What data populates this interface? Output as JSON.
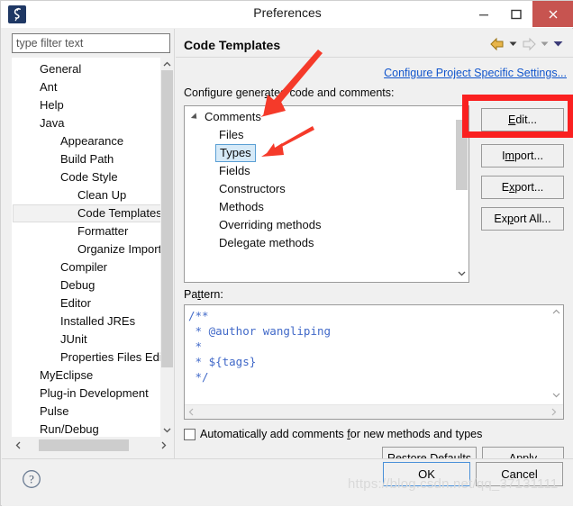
{
  "window": {
    "title": "Preferences",
    "app_icon": "myeclipse-logo-icon",
    "controls": {
      "minimize": "minimize-icon",
      "maximize": "maximize-icon",
      "close": "close-icon",
      "close_color": "#c75450"
    }
  },
  "sidebar": {
    "filter": {
      "value": "",
      "placeholder": "type filter text"
    },
    "items": [
      {
        "label": "General",
        "level": 1,
        "selected": false
      },
      {
        "label": "Ant",
        "level": 1,
        "selected": false
      },
      {
        "label": "Help",
        "level": 1,
        "selected": false
      },
      {
        "label": "Java",
        "level": 1,
        "selected": false
      },
      {
        "label": "Appearance",
        "level": 2,
        "selected": false
      },
      {
        "label": "Build Path",
        "level": 2,
        "selected": false
      },
      {
        "label": "Code Style",
        "level": 2,
        "selected": false
      },
      {
        "label": "Clean Up",
        "level": 3,
        "selected": false
      },
      {
        "label": "Code Templates",
        "level": 3,
        "selected": true
      },
      {
        "label": "Formatter",
        "level": 3,
        "selected": false
      },
      {
        "label": "Organize Imports",
        "level": 3,
        "selected": false
      },
      {
        "label": "Compiler",
        "level": 2,
        "selected": false
      },
      {
        "label": "Debug",
        "level": 2,
        "selected": false
      },
      {
        "label": "Editor",
        "level": 2,
        "selected": false
      },
      {
        "label": "Installed JREs",
        "level": 2,
        "selected": false
      },
      {
        "label": "JUnit",
        "level": 2,
        "selected": false
      },
      {
        "label": "Properties Files Editor",
        "level": 2,
        "selected": false
      },
      {
        "label": "MyEclipse",
        "level": 1,
        "selected": false
      },
      {
        "label": "Plug-in Development",
        "level": 1,
        "selected": false
      },
      {
        "label": "Pulse",
        "level": 1,
        "selected": false
      },
      {
        "label": "Run/Debug",
        "level": 1,
        "selected": false
      }
    ],
    "scroll_up_icon": "chevron-up-icon",
    "scroll_down_icon": "chevron-down-icon",
    "scroll_left_icon": "chevron-left-icon",
    "scroll_right_icon": "chevron-right-icon"
  },
  "page": {
    "title": "Code Templates",
    "nav": {
      "back_icon": "back-arrow-icon",
      "back_dropdown_icon": "chevron-down-icon",
      "forward_icon": "forward-arrow-icon",
      "forward_dropdown_icon": "chevron-down-icon",
      "menu_icon": "chevron-down-icon",
      "back_color": "#d9a521",
      "forward_color": "#c8c8c8",
      "menu_color": "#3f3f8f"
    },
    "project_specific_link": "Configure Project Specific Settings...",
    "group_label_pre": "Configure gener",
    "group_label_mnemonic": "a",
    "group_label_post": "ted code and comments:",
    "group_label_full": "Configure generated code and comments:",
    "templates": [
      {
        "label": "Comments",
        "level": 0,
        "expanded": true,
        "selected": false,
        "twisty": "expanded-triangle-icon"
      },
      {
        "label": "Files",
        "level": 1,
        "selected": false
      },
      {
        "label": "Types",
        "level": 1,
        "selected": true
      },
      {
        "label": "Fields",
        "level": 1,
        "selected": false
      },
      {
        "label": "Constructors",
        "level": 1,
        "selected": false
      },
      {
        "label": "Methods",
        "level": 1,
        "selected": false
      },
      {
        "label": "Overriding methods",
        "level": 1,
        "selected": false
      },
      {
        "label": "Delegate methods",
        "level": 1,
        "selected": false
      }
    ],
    "buttons": {
      "edit": "Edit...",
      "import": "Import...",
      "export": "Export...",
      "export_all": "Export All..."
    },
    "pattern_label": "Pattern:",
    "pattern_value": "/**\n * @author wangliping\n *\n * ${tags}\n */",
    "auto_comment_checkbox": {
      "label": "Automatically add comments for new methods and types",
      "checked": false
    },
    "restore_defaults": "Restore Defaults",
    "apply": "Apply"
  },
  "footer": {
    "help_icon": "help-question-icon",
    "ok": "OK",
    "cancel": "Cancel"
  },
  "annotations": {
    "highlight_box_color": "#fa2020",
    "arrow_color": "#f53a2a",
    "arrow_1_target": "Comments",
    "arrow_2_target": "Types",
    "highlight_target": "Edit..."
  },
  "watermark": "https://blog.csdn.net/qq_37131111"
}
